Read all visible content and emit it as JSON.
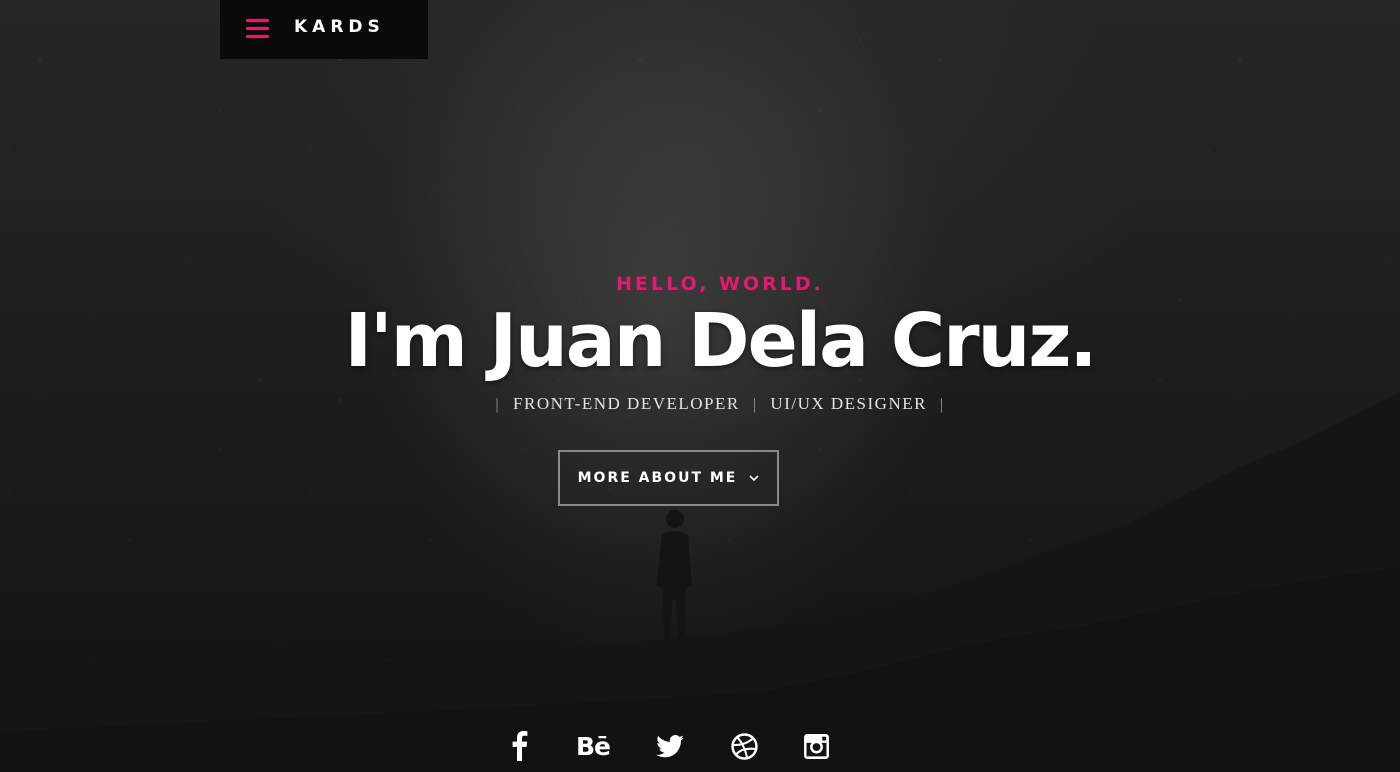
{
  "brand": {
    "name": "KARDS",
    "menu_icon": "hamburger-menu-icon",
    "accent_color": "#e5196e"
  },
  "hero": {
    "greeting": "HELLO, WORLD.",
    "name": "I'm Juan Dela Cruz.",
    "roles": [
      "FRONT-END DEVELOPER",
      "UI/UX DESIGNER"
    ],
    "separator": "|",
    "cta_label": "MORE ABOUT ME",
    "cta_icon": "chevron-down-icon"
  },
  "social": {
    "facebook_icon": "facebook-icon",
    "behance_label": "Bē",
    "behance_icon": "behance-icon",
    "twitter_icon": "twitter-icon",
    "dribbble_icon": "dribbble-icon",
    "instagram_icon": "instagram-icon"
  }
}
